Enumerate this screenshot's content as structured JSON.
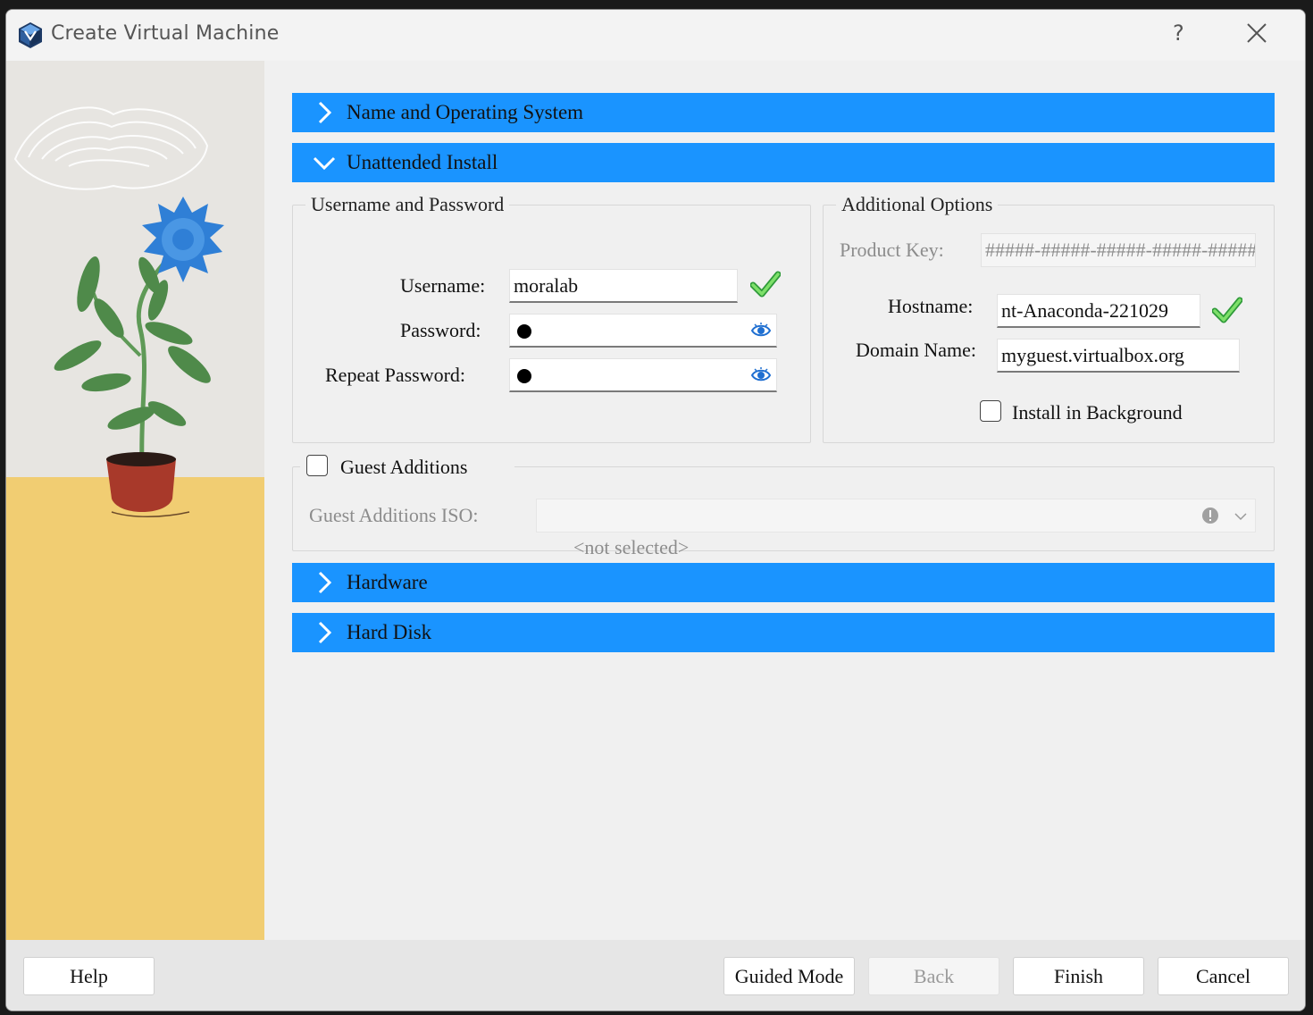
{
  "window": {
    "title": "Create Virtual Machine",
    "help_glyph": "?"
  },
  "sections": {
    "name_os": {
      "label": "Name and Operating System",
      "expanded": false
    },
    "unattended": {
      "label": "Unattended Install",
      "expanded": true
    },
    "hardware": {
      "label": "Hardware",
      "expanded": false
    },
    "hard_disk": {
      "label": "Hard Disk",
      "expanded": false
    }
  },
  "user_password": {
    "title": "Username and Password",
    "username_label": "Username:",
    "username_value": "moralab",
    "password_label": "Password:",
    "repeat_password_label": "Repeat Password:"
  },
  "additional_options": {
    "title": "Additional Options",
    "product_key_label": "Product Key:",
    "product_key_value": "#####-#####-#####-#####-#####",
    "hostname_label": "Hostname:",
    "hostname_value": "nt-Anaconda-221029",
    "domain_label": "Domain Name:",
    "domain_value": "myguest.virtualbox.org",
    "install_bg_label": "Install in Background",
    "install_bg_checked": false
  },
  "guest_additions": {
    "label": "Guest Additions",
    "checked": false,
    "iso_label": "Guest Additions ISO:",
    "iso_value": "<not selected>"
  },
  "buttons": {
    "help": "Help",
    "guided_mode": "Guided Mode",
    "back": "Back",
    "finish": "Finish",
    "cancel": "Cancel"
  },
  "colors": {
    "accent": "#1a94ff",
    "check_green": "#3cb44b",
    "eye_blue": "#1f6fd1"
  }
}
